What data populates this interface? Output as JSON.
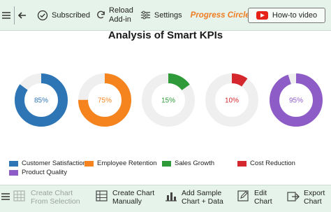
{
  "toolbar": {
    "subscribed_label": "Subscribed",
    "reload_label_line1": "Reload",
    "reload_label_line2": "Add-in",
    "settings_label": "Settings",
    "brand_title": "Progress Circle Chart",
    "howto_label": "How-to video"
  },
  "chart_data": {
    "type": "progress-circle",
    "title": "Analysis of Smart KPIs",
    "series": [
      {
        "name": "Customer Satisfaction",
        "value": 85,
        "label": "85%",
        "color": "#2e75b6"
      },
      {
        "name": "Employee Retention",
        "value": 75,
        "label": "75%",
        "color": "#f5841f"
      },
      {
        "name": "Sales Growth",
        "value": 15,
        "label": "15%",
        "color": "#2e9a3a"
      },
      {
        "name": "Cost Reduction",
        "value": 10,
        "label": "10%",
        "color": "#d5282e"
      },
      {
        "name": "Product Quality",
        "value": 95,
        "label": "95%",
        "color": "#8e5cc6"
      }
    ],
    "track_color": "#efefef",
    "legend_position": "bottom"
  },
  "bottombar": {
    "create_from_selection_line1": "Create Chart",
    "create_from_selection_line2": "From Selection",
    "create_manually_line1": "Create Chart",
    "create_manually_line2": "Manually",
    "add_sample_line1": "Add Sample",
    "add_sample_line2": "Chart + Data",
    "edit_line1": "Edit",
    "edit_line2": "Chart",
    "export_line1": "Export",
    "export_line2": "Chart"
  }
}
